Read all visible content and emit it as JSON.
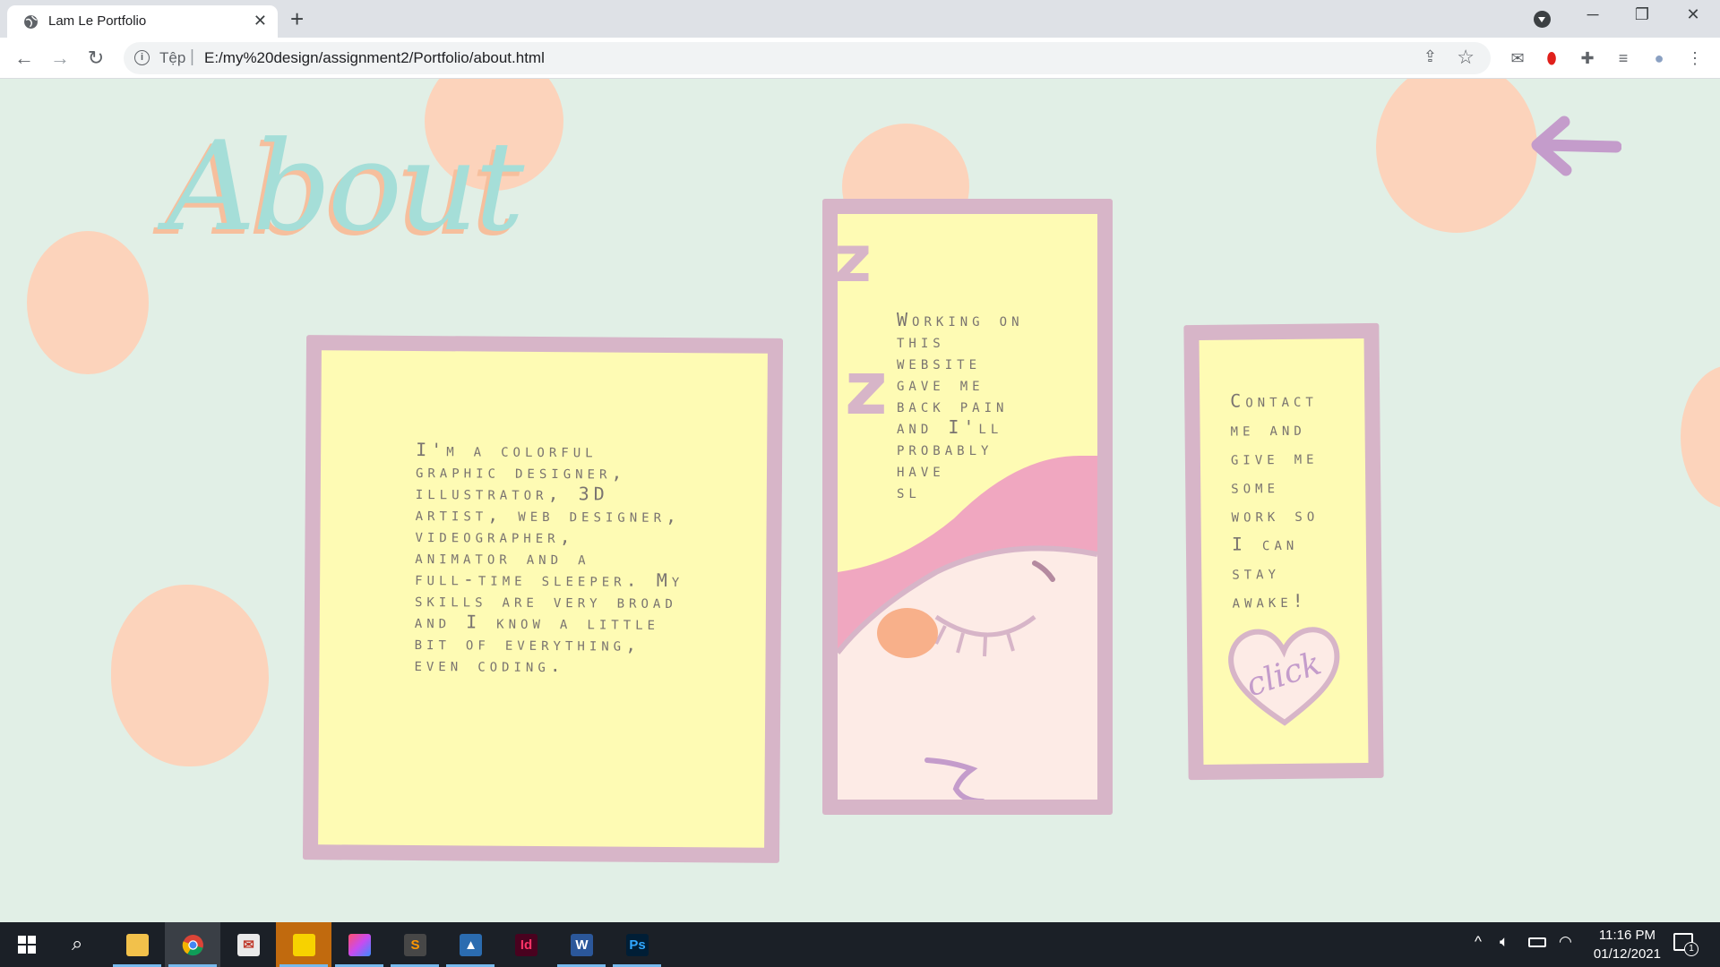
{
  "browser": {
    "tab_title": "Lam Le Portfolio",
    "new_tab": "+",
    "security_label": "Tệp",
    "url": "E:/my%20design/assignment2/Portfolio/about.html",
    "window_controls": {
      "minimize": "─",
      "restore": "❐",
      "close": "✕"
    }
  },
  "page": {
    "title": "About",
    "intro_text": "I'm a colorful\ngraphic designer,\nillustrator, 3D\nartist, web designer,\nvideographer,\nanimator and a\nfull-time sleeper. My\nskills are very broad\nand I know a little\nbit of everything,\neven coding.",
    "sleep_text": "Working on\nthis\nwebsite\ngave me\nback pain\nand I'll\nprobably\nhave\nsl",
    "sleep_zzz": [
      "z",
      "z"
    ],
    "contact_text": "Contact\nme and\ngive me\nsome\nwork so\nI can\nstay\nawake!",
    "click_label": "click"
  },
  "taskbar": {
    "apps": [
      "start",
      "search",
      "file-explorer",
      "chrome",
      "mail-app",
      "sticky-notes",
      "creative-cloud",
      "sublime-text",
      "photos",
      "indesign",
      "word",
      "photoshop"
    ],
    "app_glyphs": {
      "indesign": "Id",
      "word": "W",
      "photoshop": "Ps"
    },
    "time": "11:16 PM",
    "date": "01/12/2021",
    "notification_count": "1"
  },
  "colors": {
    "background": "#e1efe6",
    "blob": "#fcd3bb",
    "frame": "#d7b5c8",
    "paper": "#fefbb4",
    "title": "#a5ded8",
    "arrow": "#c49ccb"
  }
}
